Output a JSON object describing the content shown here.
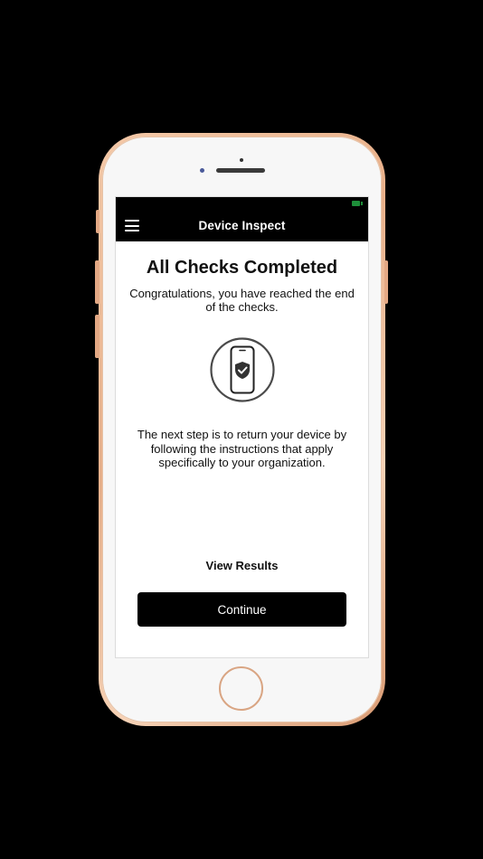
{
  "app": {
    "title": "Device Inspect"
  },
  "icons": {
    "menu": "hamburger-menu-icon",
    "illustration": "phone-shield-check-icon",
    "battery": "battery-icon"
  },
  "colors": {
    "navbar": "#000000",
    "button": "#000000",
    "battery": "#1e8f3a"
  },
  "main": {
    "heading": "All Checks Completed",
    "subtitle": "Congratulations, you have reached the end of the checks.",
    "instructions": "The next step is to return your device by following the instructions that apply specifically to your organization.",
    "view_results_label": "View Results",
    "continue_label": "Continue"
  }
}
